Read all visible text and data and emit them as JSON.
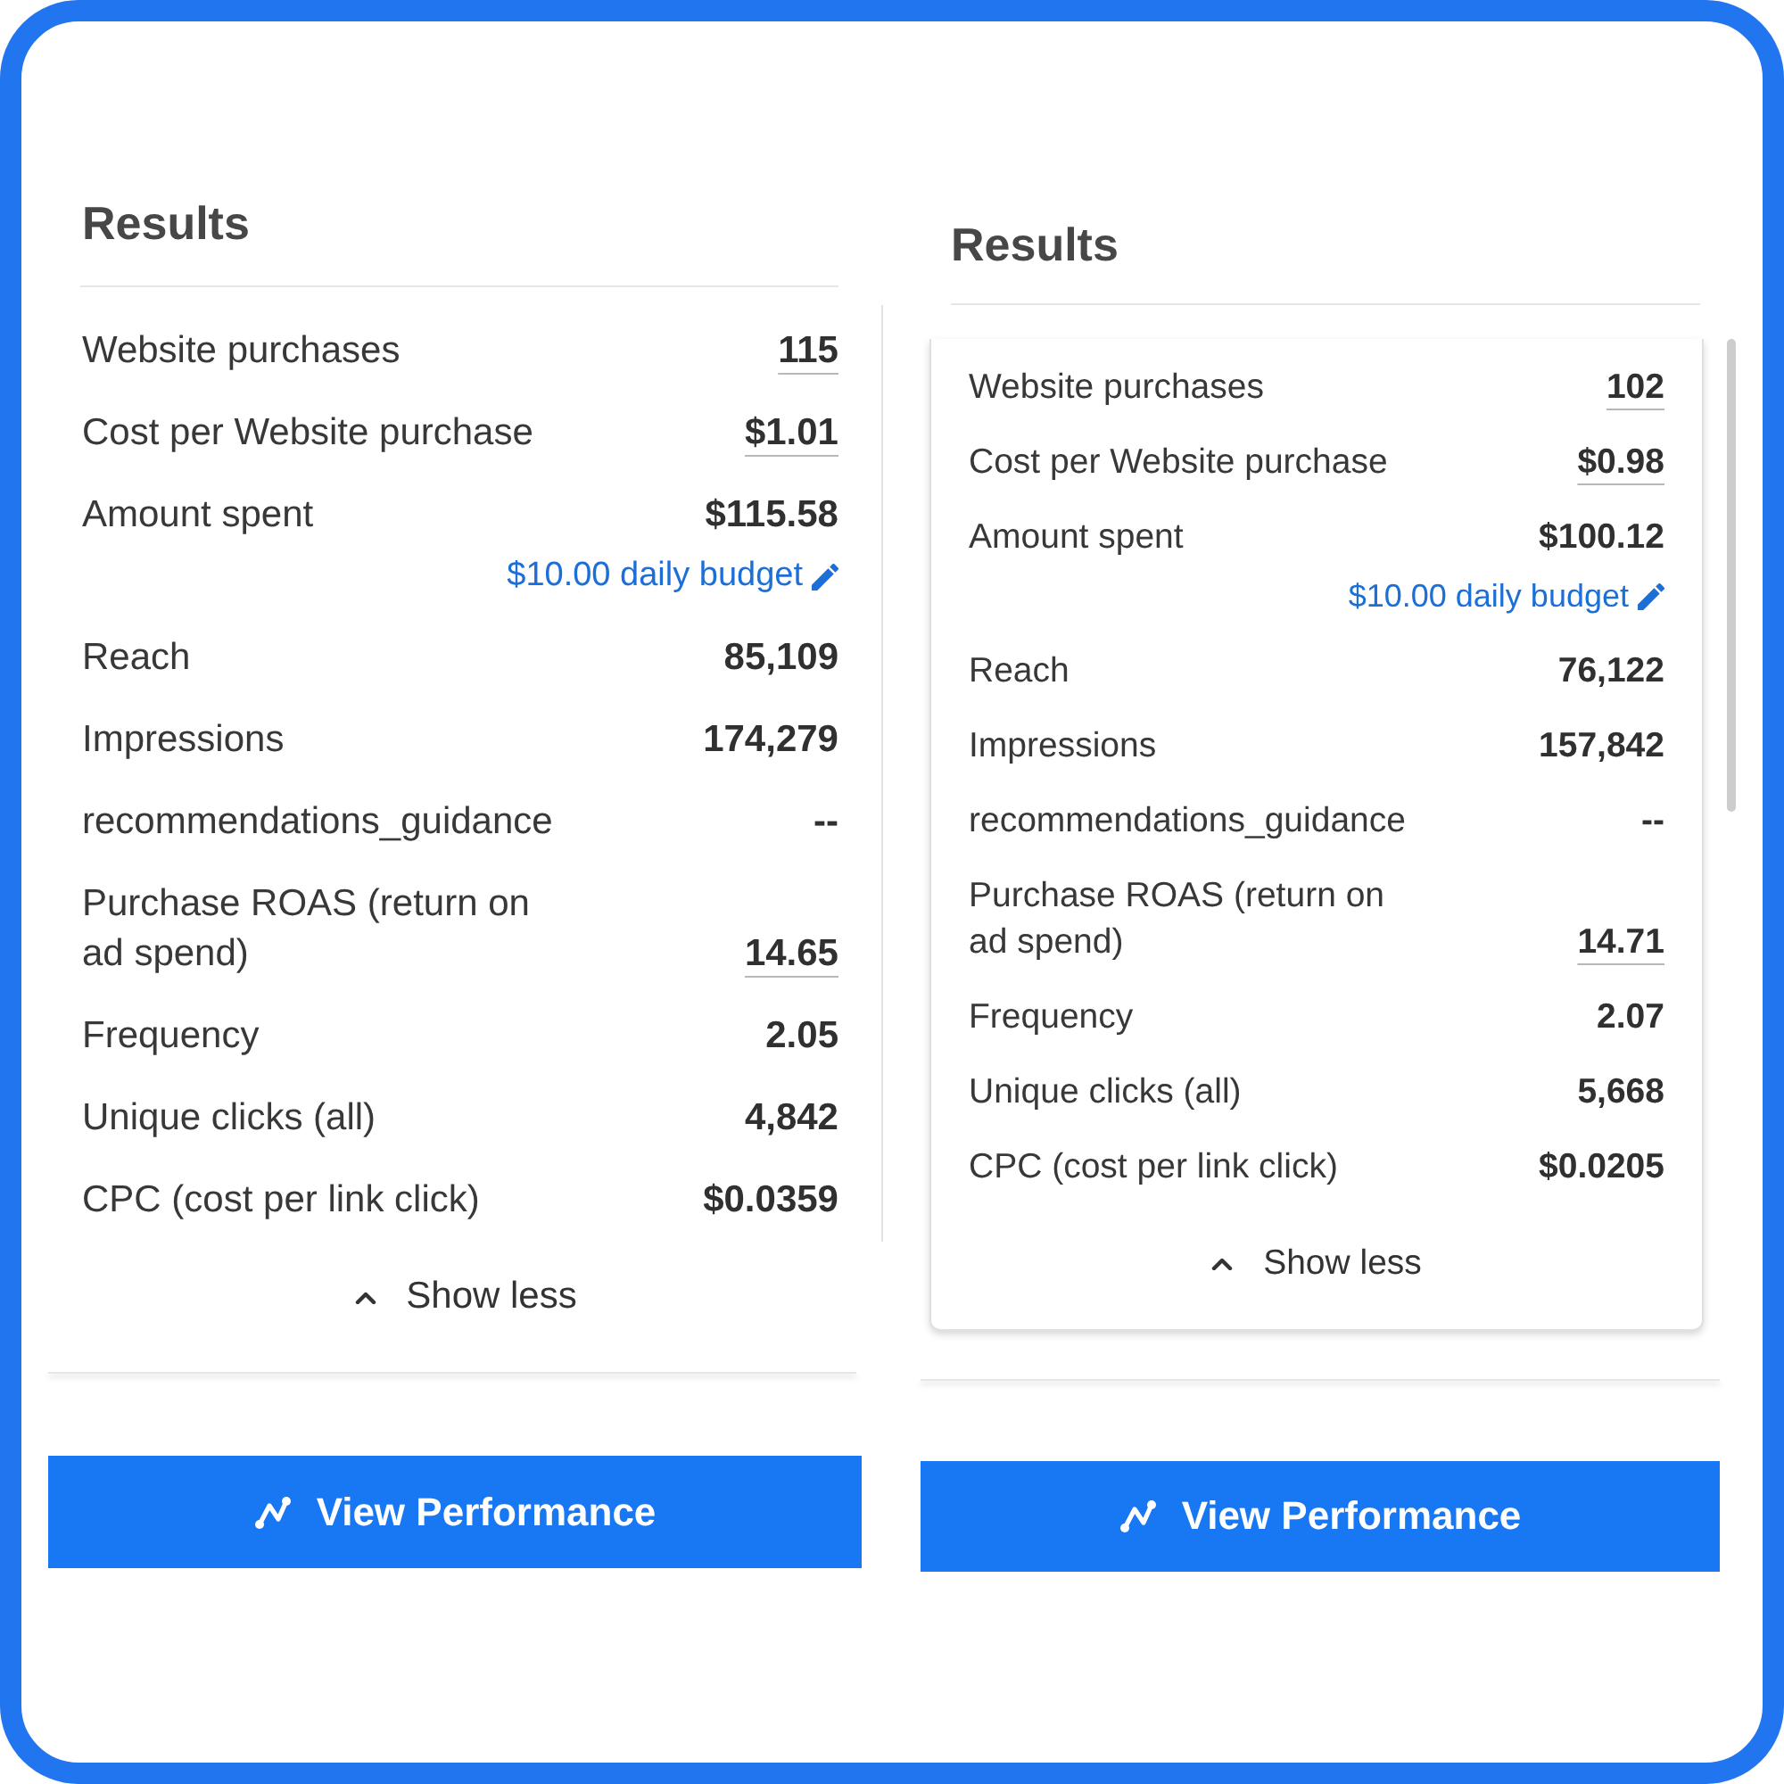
{
  "panels": [
    {
      "title": "Results",
      "metrics": [
        {
          "label": "Website purchases",
          "value": "115",
          "underlined": true
        },
        {
          "label": "Cost per Website purchase",
          "value": "$1.01",
          "underlined": true
        },
        {
          "label": "Amount spent",
          "value": "$115.58",
          "underlined": false,
          "budget": "$10.00 daily budget"
        },
        {
          "label": "Reach",
          "value": "85,109",
          "underlined": false
        },
        {
          "label": "Impressions",
          "value": "174,279",
          "underlined": false
        },
        {
          "label": "recommendations_guidance",
          "value": "--",
          "underlined": false
        },
        {
          "label": "Purchase ROAS (return on ad spend)",
          "value": "14.65",
          "underlined": true
        },
        {
          "label": "Frequency",
          "value": "2.05",
          "underlined": false
        },
        {
          "label": "Unique clicks (all)",
          "value": "4,842",
          "underlined": false
        },
        {
          "label": "CPC (cost per link click)",
          "value": "$0.0359",
          "underlined": false
        }
      ],
      "toggle": {
        "label": "Show less",
        "expanded": true
      },
      "button": {
        "label": "View Performance"
      }
    },
    {
      "title": "Results",
      "metrics": [
        {
          "label": "Website purchases",
          "value": "102",
          "underlined": true
        },
        {
          "label": "Cost per Website purchase",
          "value": "$0.98",
          "underlined": true
        },
        {
          "label": "Amount spent",
          "value": "$100.12",
          "underlined": false,
          "budget": "$10.00 daily budget"
        },
        {
          "label": "Reach",
          "value": "76,122",
          "underlined": false
        },
        {
          "label": "Impressions",
          "value": "157,842",
          "underlined": false
        },
        {
          "label": "recommendations_guidance",
          "value": "--",
          "underlined": false
        },
        {
          "label": "Purchase ROAS (return on ad spend)",
          "value": "14.71",
          "underlined": true
        },
        {
          "label": "Frequency",
          "value": "2.07",
          "underlined": false
        },
        {
          "label": "Unique clicks (all)",
          "value": "5,668",
          "underlined": false
        },
        {
          "label": "CPC (cost per link click)",
          "value": "$0.0205",
          "underlined": false
        }
      ],
      "toggle": {
        "label": "Show less",
        "expanded": true
      },
      "button": {
        "label": "View Performance"
      }
    }
  ]
}
